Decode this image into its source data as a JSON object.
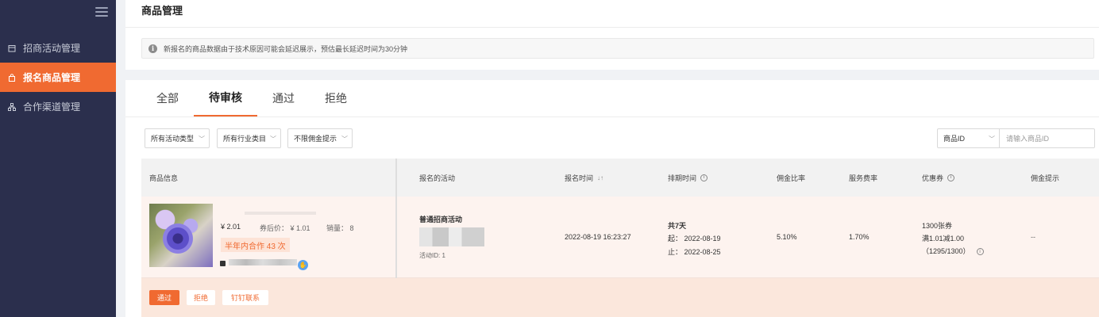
{
  "sidebar": {
    "items": [
      {
        "label": "招商活动管理",
        "icon": "calendar-icon"
      },
      {
        "label": "报名商品管理",
        "icon": "bag-icon",
        "active": true
      },
      {
        "label": "合作渠道管理",
        "icon": "network-icon"
      }
    ]
  },
  "header": {
    "title": "商品管理",
    "notice": "新报名的商品数据由于技术原因可能会延迟展示，预估最长延迟时间为30分钟"
  },
  "tabs": [
    "全部",
    "待审核",
    "通过",
    "拒绝"
  ],
  "active_tab": "待审核",
  "filters": {
    "activity_type": "所有活动类型",
    "industry": "所有行业类目",
    "commission": "不限佣金提示",
    "id_select": "商品ID",
    "id_placeholder": "请输入商品ID"
  },
  "table": {
    "headers": {
      "product_info": "商品信息",
      "activity": "报名的活动",
      "reg_time": "报名时间",
      "schedule": "排期时间",
      "commission_rate": "佣金比率",
      "service_rate": "服务费率",
      "coupon": "优惠券",
      "commission_tip": "佣金提示"
    },
    "row": {
      "price": "¥ 2.01",
      "coupon_price": "券后价：  ¥ 1.01",
      "sales": "销量：  8",
      "coop_badge": "半年内合作 43 次",
      "activity_name": "普通招商活动",
      "activity_id": "活动ID: 1",
      "reg_time": "2022-08-19 16:23:27",
      "schedule_total": "共7天",
      "schedule_start": "起：  2022-08-19",
      "schedule_end": "止：  2022-08-25",
      "commission_rate": "5.10%",
      "service_rate": "1.70%",
      "coupon_count": "1300张券",
      "coupon_rule": "满1.01减1.00",
      "coupon_remaining": "（1295/1300）",
      "commission_tip": "--"
    },
    "actions": {
      "pass": "通过",
      "reject": "拒绝",
      "dingtalk": "钉钉联系"
    }
  },
  "colors": {
    "accent": "#f06a31",
    "sidebar_bg": "#2b2f4d"
  }
}
